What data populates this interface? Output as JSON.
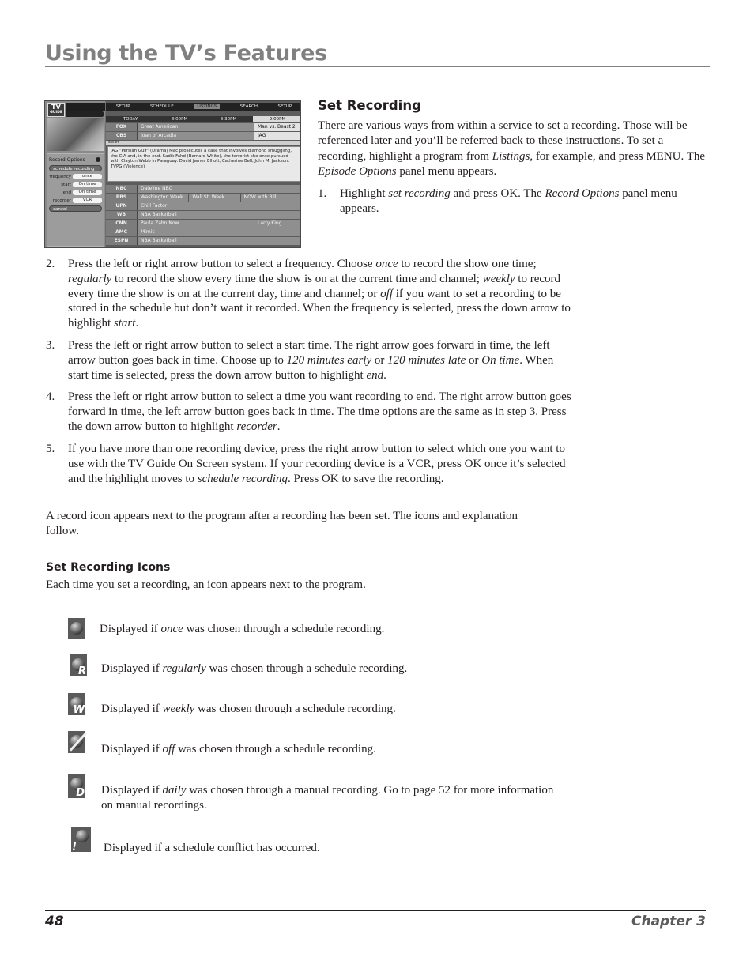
{
  "header": {
    "title": "Using the TV’s Features"
  },
  "screenshot": {
    "logo_top": "TV",
    "logo_bottom": "GUIDE",
    "menu": [
      "SETUP",
      "SCHEDULE",
      "LISTINGS",
      "SEARCH",
      "SETUP"
    ],
    "menu_active_index": 2,
    "times": [
      "TODAY",
      "8:00PM",
      "8:30PM",
      "9:00PM"
    ],
    "rows_top": [
      {
        "channel": "FOX",
        "cells": [
          "Great American",
          "Man vs. Beast 2"
        ]
      },
      {
        "channel": "CBS",
        "cells": [
          "Joan of Arcadia",
          "JAG"
        ]
      }
    ],
    "desc_channel": "8WSH",
    "description": "JAG \"Persian Gulf\" (Drama) Mac prosecutes a case that involves diamond smuggling, the CIA and, in the end, Sadik Fahd (Bernard White), the terrorist she once pursued with Clayton Webb in Paraguay. David James Elliott, Catherine Bell, John M. Jackson. TVPG (Violence)",
    "rows_bottom": [
      {
        "channel": "NBC",
        "cells": [
          "Dateline NBC"
        ]
      },
      {
        "channel": "PBS",
        "cells": [
          "Washington Week",
          "Wall St. Week",
          "NOW with Bill..."
        ]
      },
      {
        "channel": "UPN",
        "cells": [
          "Chill Factor"
        ]
      },
      {
        "channel": "WB",
        "cells": [
          "NBA Basketball"
        ]
      },
      {
        "channel": "CNN",
        "cells": [
          "Paula Zahn Now",
          "Larry King"
        ]
      },
      {
        "channel": "AMC",
        "cells": [
          "Mimic"
        ]
      },
      {
        "channel": "ESPN",
        "cells": [
          "NBA Basketball"
        ]
      }
    ],
    "panel": {
      "title": "Record Options",
      "schedule_button": "schedule recording",
      "options": [
        {
          "label": "frequency",
          "value": "once"
        },
        {
          "label": "start",
          "value": "On time"
        },
        {
          "label": "end",
          "value": "On time"
        },
        {
          "label": "recorder",
          "value": "VCR"
        }
      ],
      "cancel_button": "cancel"
    }
  },
  "set_recording": {
    "heading": "Set Recording",
    "intro_parts": [
      "There are various ways from within a service to set a recording. Those will be referenced later and you’ll be referred back to these instructions. To set a recording, highlight a program from ",
      "Listings",
      ", for example, and press MENU. The ",
      "Episode Options",
      " panel menu appears."
    ],
    "steps": [
      {
        "num": "1.",
        "parts": [
          "Highlight ",
          "set recording",
          " and press OK. The ",
          "Record Options",
          " panel menu appears."
        ]
      },
      {
        "num": "2.",
        "parts": [
          "Press the left or right arrow button to select a frequency. Choose ",
          "once",
          " to record the show one time; ",
          "regularly",
          " to record the show every time the show is on at the current time and channel; ",
          "weekly",
          " to record every time the show is on at the current day, time and channel; or ",
          "off",
          " if you want to set a recording to be stored in the schedule but don’t want it recorded. When the frequency is selected, press the down arrow to highlight ",
          "start",
          "."
        ]
      },
      {
        "num": "3.",
        "parts": [
          "Press the left or right arrow button to select a start time. The right arrow goes forward in time, the left arrow button goes back in time. Choose up to ",
          "120 minutes early",
          " or ",
          "120 minutes late",
          " or ",
          "On time",
          ". When start time is selected, press the down arrow button to highlight ",
          "end",
          "."
        ]
      },
      {
        "num": "4.",
        "parts": [
          "Press the left or right arrow button to select a time you want recording to end. The right arrow button goes forward in time, the left arrow button goes back in time. The time options are the same as in step 3. Press the down arrow button to highlight ",
          "recorder",
          "."
        ]
      },
      {
        "num": "5.",
        "parts": [
          "If you have more than one recording device, press the right arrow button to select which one you want to use with the TV Guide On Screen system. If your recording device is a VCR, press OK once it’s selected and the highlight moves to ",
          "schedule recording",
          ". Press OK to save the recording."
        ]
      }
    ],
    "after_text": "A record icon appears next to the program after a recording has been set. The icons and explanation follow."
  },
  "icons_section": {
    "heading": "Set Recording Icons",
    "intro": "Each time you set a recording, an icon appears next to the program.",
    "items": [
      {
        "icon": "record-once-icon",
        "letter": "",
        "parts": [
          "Displayed if ",
          "once",
          " was chosen through a schedule recording."
        ]
      },
      {
        "icon": "record-regularly-icon",
        "letter": "R",
        "parts": [
          "Displayed if ",
          "regularly",
          " was chosen through a schedule recording."
        ]
      },
      {
        "icon": "record-weekly-icon",
        "letter": "W",
        "parts": [
          "Displayed if ",
          "weekly",
          " was chosen through a schedule recording."
        ]
      },
      {
        "icon": "record-off-icon",
        "letter": "",
        "parts": [
          "Displayed if ",
          "off",
          " was chosen through a schedule recording."
        ]
      },
      {
        "icon": "record-daily-icon",
        "letter": "D",
        "parts": [
          "Displayed if ",
          "daily",
          " was chosen through a manual recording. Go to page 52 for more information on manual recordings."
        ]
      },
      {
        "icon": "schedule-conflict-icon",
        "letter": "!",
        "parts": [
          "Displayed if a schedule conflict has occurred.",
          "",
          ""
        ]
      }
    ]
  },
  "footer": {
    "page_number": "48",
    "chapter": "Chapter 3"
  }
}
